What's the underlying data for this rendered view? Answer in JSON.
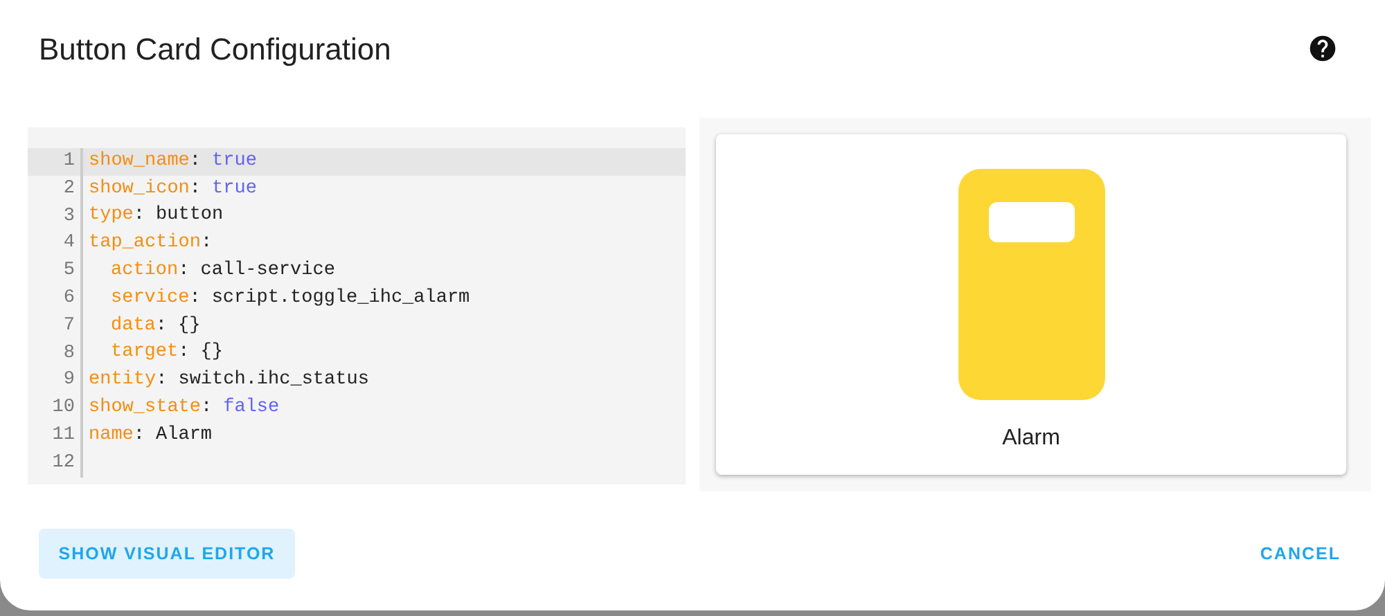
{
  "dialog": {
    "title": "Button Card Configuration"
  },
  "editor": {
    "lines": [
      {
        "number": "1",
        "key": "show_name",
        "colon": ":",
        "value": "true",
        "kind": "boolean",
        "selected": true
      },
      {
        "number": "2",
        "key": "show_icon",
        "colon": ":",
        "value": "true",
        "kind": "boolean",
        "selected": false
      },
      {
        "number": "3",
        "key": "type",
        "colon": ":",
        "value": "button",
        "kind": "plain",
        "selected": false
      },
      {
        "number": "4",
        "key": "tap_action",
        "colon": ":",
        "selected": false,
        "children": [
          {
            "number": "5",
            "key": "action",
            "colon": ":",
            "value": "call-service",
            "kind": "plain",
            "selected": false
          },
          {
            "number": "6",
            "key": "service",
            "colon": ":",
            "value": "script.toggle_ihc_alarm",
            "kind": "plain",
            "selected": false
          },
          {
            "number": "7",
            "key": "data",
            "colon": ":",
            "value": "{}",
            "kind": "plain",
            "selected": false
          },
          {
            "number": "8",
            "key": "target",
            "colon": ":",
            "value": "{}",
            "kind": "plain",
            "selected": false
          }
        ]
      },
      {
        "number": "9",
        "key": "entity",
        "colon": ":",
        "value": "switch.ihc_status",
        "kind": "plain",
        "selected": false
      },
      {
        "number": "10",
        "key": "show_state",
        "colon": ":",
        "value": "false",
        "kind": "boolean",
        "selected": false
      },
      {
        "number": "11",
        "key": "name",
        "colon": ":",
        "value": "Alarm",
        "kind": "plain",
        "selected": false
      },
      {
        "number": "12",
        "selected": false
      }
    ]
  },
  "preview": {
    "name": "Alarm"
  },
  "buttons": {
    "left": "SHOW VISUAL EDITOR",
    "right": "CANCEL"
  }
}
